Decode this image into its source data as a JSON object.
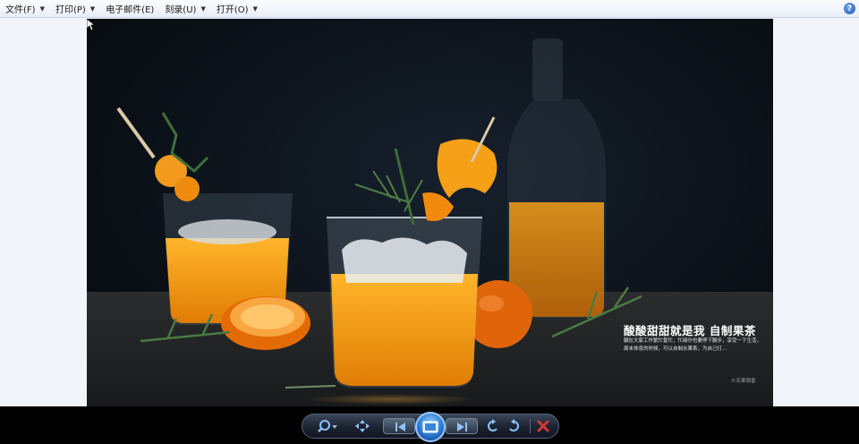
{
  "menu": {
    "items": [
      {
        "label": "文件(F)",
        "has_dropdown": true
      },
      {
        "label": "打印(P)",
        "has_dropdown": true
      },
      {
        "label": "电子邮件(E)",
        "has_dropdown": false
      },
      {
        "label": "刻录(U)",
        "has_dropdown": true
      },
      {
        "label": "打开(O)",
        "has_dropdown": true
      }
    ],
    "help_label": "?"
  },
  "photo": {
    "caption_title": "酸酸甜甜就是我 自制果茶",
    "caption_body": "願在大家工作繁忙髮忙，忙碌尔也要停下腳步，享受一下生活，周末休息的时候，可以自制水果茶，为自己打...",
    "watermark": "©花果頭香"
  },
  "controls": {
    "icons": [
      "zoom-icon",
      "fit-to-window-icon",
      "previous-icon",
      "slideshow-icon",
      "next-icon",
      "rotate-counterclockwise-icon",
      "rotate-clockwise-icon",
      "delete-icon"
    ]
  },
  "colors": {
    "menubar_bg": "#eef2fa",
    "viewer_bg": "#f1f4fa",
    "controlbar_bg": "#000000",
    "accent_blue": "#2c78d0",
    "delete_red": "#d23a3a",
    "juice_orange": "#f29a10"
  }
}
